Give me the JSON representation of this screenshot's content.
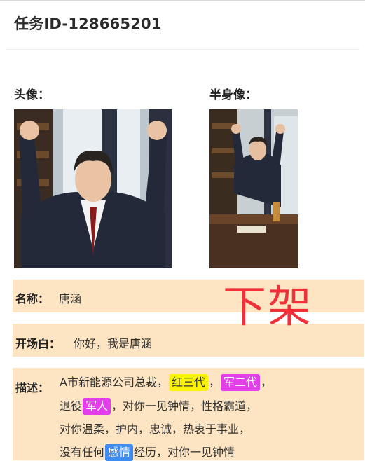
{
  "header": {
    "title": "任务ID-128665201"
  },
  "images": {
    "avatar_label": "头像：",
    "half_body_label": "半身像："
  },
  "fields": {
    "name_label": "名称：",
    "name_value": "唐涵",
    "opening_label": "开场白：",
    "opening_value": "你好，我是唐涵",
    "description_label": "描述："
  },
  "description": {
    "line1_a": "A市新能源公司总裁，",
    "tag_red_gen3": "红三代",
    "sep1": "，",
    "tag_army_gen3": "军二代",
    "sep2": "，",
    "line2_a": "退役",
    "tag_soldier": "军人",
    "line2_b": "，对你一见钟情，性格霸道，",
    "line3": "对你温柔，护内，忠诚，热衷于事业，",
    "line4_a": "没有任何",
    "tag_emotion": "感情",
    "line4_b": "经历，对你一见钟情"
  },
  "stamp": {
    "text": "下架",
    "color": "#f0313a"
  },
  "colors": {
    "row_background": "#fde4c2",
    "tag_yellow": "#fbf307",
    "tag_magenta": "#e23fea",
    "tag_blue": "#3f8cf0"
  }
}
